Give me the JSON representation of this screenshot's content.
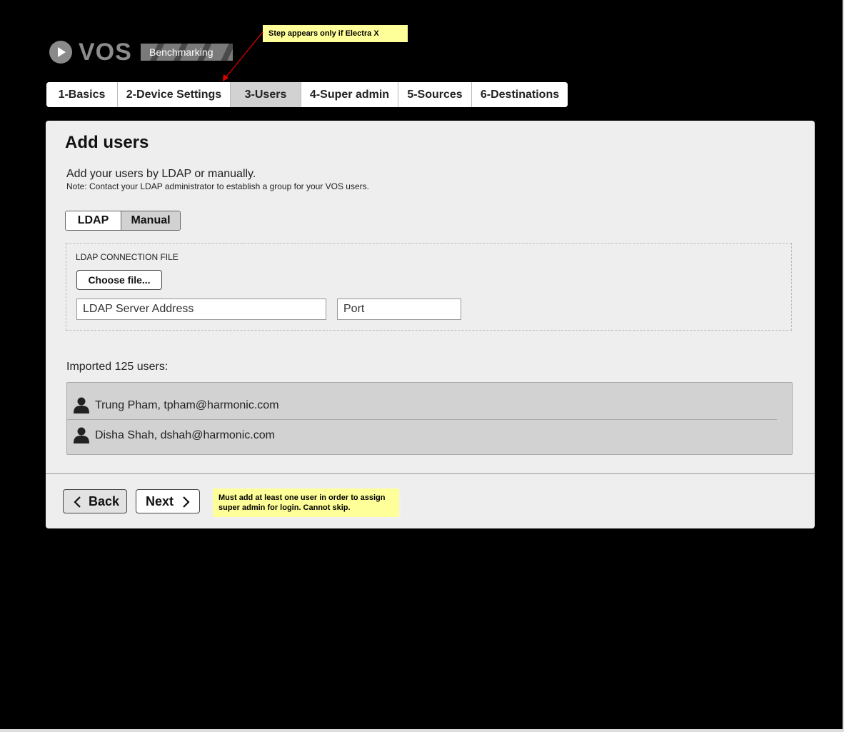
{
  "logo": {
    "name": "VOS",
    "tagline": "Benchmarking"
  },
  "annotations": {
    "tab_note": "Step appears only if Electra X",
    "next_note": "Must add at least one user in order to assign super admin for login. Cannot skip."
  },
  "tabs": [
    {
      "label": "1-Basics"
    },
    {
      "label": "2-Device Settings"
    },
    {
      "label": "3-Users",
      "active": true
    },
    {
      "label": "4-Super admin"
    },
    {
      "label": "5-Sources"
    },
    {
      "label": "6-Destinations"
    }
  ],
  "panel": {
    "title": "Add users",
    "intro": "Add your users by LDAP or manually.",
    "note": "Note: Contact your LDAP administrator to establish a group for your VOS users.",
    "toggle": {
      "ldap": "LDAP",
      "manual": "Manual",
      "selected": "LDAP"
    },
    "ldap": {
      "section_label": "LDAP CONNECTION FILE",
      "choose_file_label": "Choose file...",
      "server_placeholder": "LDAP Server Address",
      "port_placeholder": "Port"
    },
    "imported_label": "Imported 125 users:",
    "users": [
      {
        "text": "Trung Pham, tpham@harmonic.com",
        "icon": "person-icon"
      },
      {
        "text": "Disha Shah, dshah@harmonic.com",
        "icon": "person-icon"
      }
    ],
    "back_label": "Back",
    "next_label": "Next"
  },
  "colors": {
    "background": "#000000",
    "panel": "#eeeeee",
    "active_tab": "#d2d2d2",
    "sticky_note": "#ffff99",
    "arrow": "#e00000"
  }
}
